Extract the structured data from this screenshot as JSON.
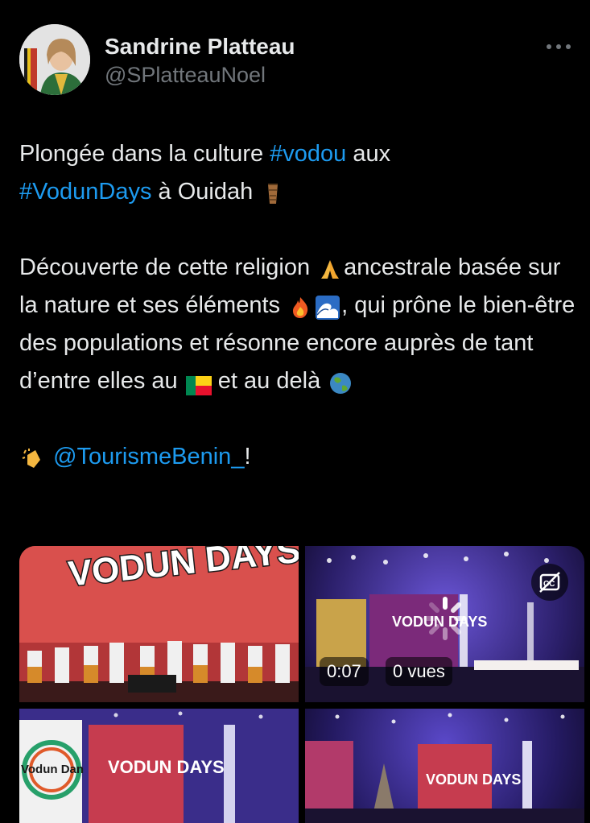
{
  "author": {
    "display_name": "Sandrine Platteau",
    "handle": "@SPlatteauNoel"
  },
  "header": {
    "more_icon": "more-dots-icon"
  },
  "tweet": {
    "line1_pre": "Plongée dans la culture ",
    "hashtag1": "#vodou",
    "line1_post": " aux",
    "hashtag2": "#VodunDays",
    "line2_post": " à Ouidah ",
    "para2_a": "Découverte de cette religion ",
    "para2_b": "ancestrale basée sur la nature et ses éléments ",
    "para2_c": ", qui prône le bien-être des populations et résonne encore auprès de tant d’entre elles au ",
    "para2_d": " et au delà ",
    "mention": "@TourismeBenin_",
    "mention_post": "!"
  },
  "media": {
    "tile1_text": "VODUN DAYS",
    "tile2_stage_text": "VODUN DAYS",
    "video_time": "0:07",
    "video_views": "0 vues",
    "tile3_text_left": "Vodun Dan",
    "tile3_text": "VODUN DAYS",
    "tile4_text": "VODUN DAYS"
  },
  "colors": {
    "link": "#1d9bf0",
    "background": "#000000",
    "text": "#e7e9ea",
    "secondary": "#71767b"
  }
}
